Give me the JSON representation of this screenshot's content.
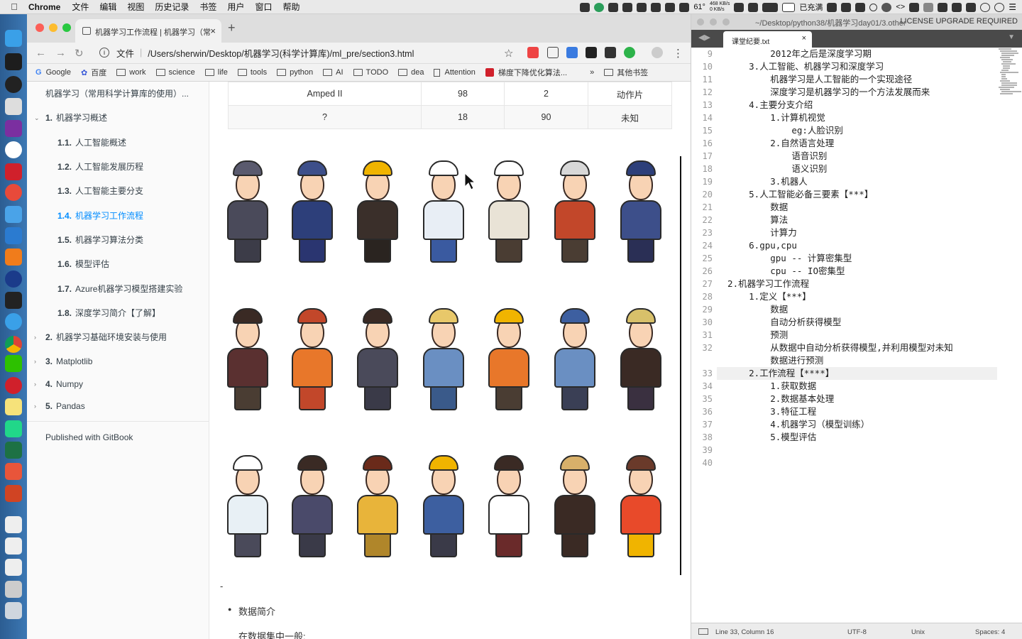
{
  "menubar": {
    "apple": "",
    "app": "Chrome",
    "items": [
      "文件",
      "编辑",
      "视图",
      "历史记录",
      "书签",
      "用户",
      "窗口",
      "帮助"
    ],
    "battery": "61°",
    "net_up": "468 KB/s",
    "net_down": "0 KB/s",
    "charge": "已充满"
  },
  "browser": {
    "tab_title": "机器学习工作流程 | 机器学习（常",
    "tab_close": "×",
    "new_tab": "+",
    "back": "←",
    "forward": "→",
    "reload": "↻",
    "address_label": "文件",
    "address": "/Users/sherwin/Desktop/机器学习(科学计算库)/ml_pre/section3.html",
    "star": "☆",
    "menu": "⋮",
    "bookmarks": [
      "Google",
      "百度",
      "work",
      "science",
      "life",
      "tools",
      "python",
      "AI",
      "TODO",
      "dea",
      "Attention",
      "梯度下降优化算法...",
      "»",
      "其他书签"
    ]
  },
  "sidebar": {
    "book_title": "机器学习（常用科学计算库的使用）...",
    "items": [
      {
        "num": "1.",
        "label": "机器学习概述",
        "caret": "⌄"
      },
      {
        "num": "1.1.",
        "label": "人工智能概述"
      },
      {
        "num": "1.2.",
        "label": "人工智能发展历程"
      },
      {
        "num": "1.3.",
        "label": "人工智能主要分支"
      },
      {
        "num": "1.4.",
        "label": "机器学习工作流程"
      },
      {
        "num": "1.5.",
        "label": "机器学习算法分类"
      },
      {
        "num": "1.6.",
        "label": "模型评估"
      },
      {
        "num": "1.7.",
        "label": "Azure机器学习模型搭建实验"
      },
      {
        "num": "1.8.",
        "label": "深度学习简介【了解】"
      },
      {
        "num": "2.",
        "label": "机器学习基础环境安装与使用",
        "caret": "›"
      },
      {
        "num": "3.",
        "label": "Matplotlib",
        "caret": "›"
      },
      {
        "num": "4.",
        "label": "Numpy",
        "caret": "›"
      },
      {
        "num": "5.",
        "label": "Pandas",
        "caret": "›"
      }
    ],
    "footer": "Published with GitBook"
  },
  "content": {
    "table_rows": [
      [
        "Amped II",
        "98",
        "2",
        "动作片"
      ],
      [
        "?",
        "18",
        "90",
        "未知"
      ]
    ],
    "dash": "-",
    "bullet_title": "数据简介",
    "paragraph": "在数据集中一般:"
  },
  "editor": {
    "title_path": "~/Desktop/python38/机器学习day01/3.other",
    "license": "LICENSE UPGRADE REQUIRED",
    "file_tab": "课堂纪要.txt",
    "tab_close": "×",
    "lines": [
      {
        "n": "9",
        "t": "          2012年之后是深度学习期"
      },
      {
        "n": "10",
        "t": "      3.人工智能、机器学习和深度学习"
      },
      {
        "n": "11",
        "t": "          机器学习是人工智能的一个实现途径"
      },
      {
        "n": "12",
        "t": "          深度学习是机器学习的一个方法发展而来"
      },
      {
        "n": "13",
        "t": "      4.主要分支介绍"
      },
      {
        "n": "14",
        "t": "          1.计算机视觉"
      },
      {
        "n": "15",
        "t": "              eg:人脸识别"
      },
      {
        "n": "16",
        "t": "          2.自然语言处理"
      },
      {
        "n": "17",
        "t": "              语音识别"
      },
      {
        "n": "18",
        "t": "              语义识别"
      },
      {
        "n": "19",
        "t": "          3.机器人"
      },
      {
        "n": "20",
        "t": "      5.人工智能必备三要素【***】"
      },
      {
        "n": "21",
        "t": "          数据"
      },
      {
        "n": "22",
        "t": "          算法"
      },
      {
        "n": "23",
        "t": "          计算力"
      },
      {
        "n": "24",
        "t": "      6.gpu,cpu"
      },
      {
        "n": "25",
        "t": "          gpu -- 计算密集型"
      },
      {
        "n": "26",
        "t": "          cpu -- IO密集型"
      },
      {
        "n": "27",
        "t": "  2.机器学习工作流程"
      },
      {
        "n": "28",
        "t": "      1.定义【***】"
      },
      {
        "n": "29",
        "t": "          数据"
      },
      {
        "n": "30",
        "t": "          自动分析获得模型"
      },
      {
        "n": "31",
        "t": "          预测"
      },
      {
        "n": "32",
        "t": "          从数据中自动分析获得模型,并利用模型对未知"
      },
      {
        "n": "",
        "t": "          数据进行预测"
      },
      {
        "n": "33",
        "t": "      2.工作流程【****】"
      },
      {
        "n": "34",
        "t": "          1.获取数据"
      },
      {
        "n": "35",
        "t": "          2.数据基本处理"
      },
      {
        "n": "36",
        "t": "          3.特征工程"
      },
      {
        "n": "37",
        "t": "          4.机器学习（模型训练）"
      },
      {
        "n": "38",
        "t": "          5.模型评估"
      },
      {
        "n": "39",
        "t": ""
      },
      {
        "n": "40",
        "t": ""
      }
    ],
    "status": {
      "position": "Line 33, Column 16",
      "encoding": "UTF-8",
      "line_endings": "Unix",
      "indent": "Spaces: 4"
    }
  },
  "colors": {
    "link_active": "#008cff",
    "sidebar_bg": "#fafafa",
    "dock": "#3c78b4"
  }
}
